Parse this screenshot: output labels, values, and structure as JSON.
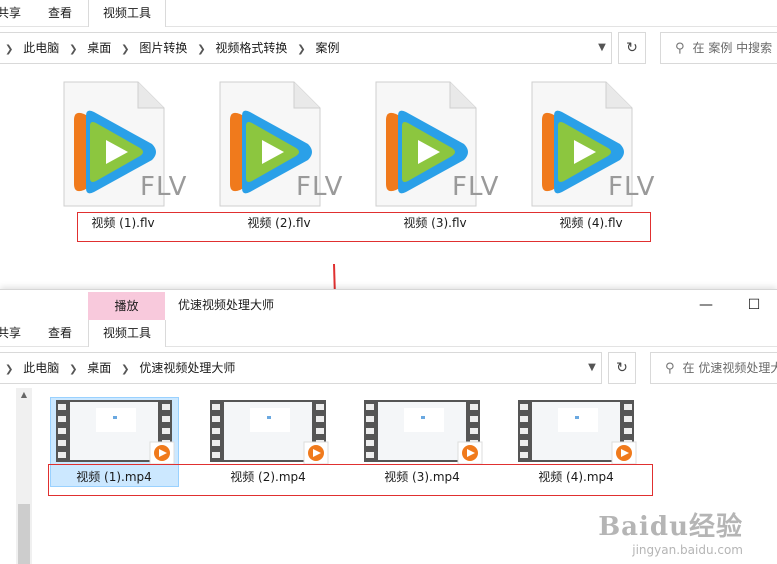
{
  "top_window": {
    "ribbon_tabs": [
      {
        "label": "共享"
      },
      {
        "label": "查看"
      },
      {
        "label": "视频工具"
      }
    ],
    "breadcrumbs": [
      "此电脑",
      "桌面",
      "图片转换",
      "视频格式转换",
      "案例"
    ],
    "search_placeholder": "在 案例 中搜索",
    "file_badge": "FLV",
    "files": [
      {
        "name": "视频 (1).flv"
      },
      {
        "name": "视频 (2).flv"
      },
      {
        "name": "视频 (3).flv"
      },
      {
        "name": "视频 (4).flv"
      }
    ]
  },
  "bottom_window": {
    "context_tab": "播放",
    "title": "优速视频处理大师",
    "ribbon_tabs": [
      {
        "label": "共享"
      },
      {
        "label": "查看"
      },
      {
        "label": "视频工具"
      }
    ],
    "breadcrumbs": [
      "此电脑",
      "桌面",
      "优速视频处理大师"
    ],
    "search_placeholder": "在 优速视频处理大师 中搜索",
    "files": [
      {
        "name": "视频 (1).mp4"
      },
      {
        "name": "视频 (2).mp4"
      },
      {
        "name": "视频 (3).mp4"
      },
      {
        "name": "视频 (4).mp4"
      }
    ]
  },
  "watermark": {
    "logo": "Baidu经验",
    "url": "jingyan.baidu.com"
  },
  "colors": {
    "annotation_red": "#e03030",
    "context_tab_pink": "#f8c9dc",
    "selection_blue": "#cce8ff"
  }
}
